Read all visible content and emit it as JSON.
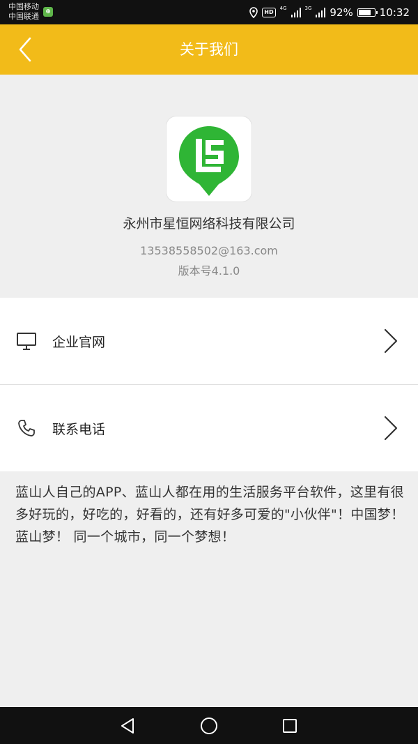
{
  "status_bar": {
    "carrier_1": "中国移动",
    "carrier_2": "中国联通",
    "hd_label": "HD",
    "network_1": "4G",
    "network_2": "3G",
    "battery_level": 92,
    "battery_text": "92%",
    "time": "10:32"
  },
  "header": {
    "title": "关于我们",
    "back_icon": "chevron-left-icon"
  },
  "about": {
    "company_name": "永州市星恒网络科技有限公司",
    "email": "13538558502@163.com",
    "version": "版本号4.1.0",
    "logo_color": "#2fb535"
  },
  "menu": {
    "items": [
      {
        "label": "企业官网",
        "icon": "monitor-icon"
      },
      {
        "label": "联系电话",
        "icon": "phone-icon"
      }
    ]
  },
  "description": "蓝山人自己的APP、蓝山人都在用的生活服务平台软件，这里有很多好玩的，好吃的，好看的，还有好多可爱的\"小伙伴\"！中国梦！蓝山梦！ 同一个城市，同一个梦想！",
  "colors": {
    "header": "#f2bb19",
    "background": "#efefef"
  }
}
